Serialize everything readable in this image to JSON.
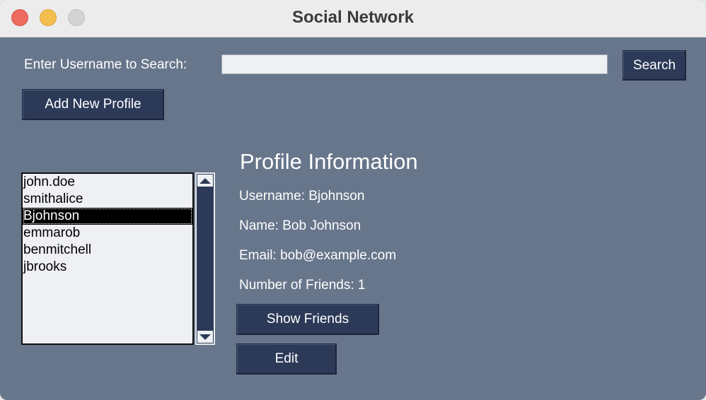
{
  "window": {
    "title": "Social Network"
  },
  "search": {
    "label": "Enter Username to Search:",
    "value": "",
    "placeholder": "",
    "button_label": "Search"
  },
  "actions": {
    "add_profile_label": "Add New Profile",
    "show_friends_label": "Show Friends",
    "edit_label": "Edit"
  },
  "profile_list": {
    "items": [
      "john.doe",
      "smithalice",
      "Bjohnson",
      "emmarob",
      "benmitchell",
      "jbrooks"
    ],
    "selected": "Bjohnson"
  },
  "profile": {
    "heading": "Profile Information",
    "username_line": "Username: Bjohnson",
    "name_line": "Name: Bob Johnson",
    "email_line": "Email: bob@example.com",
    "friends_line": "Number of Friends: 1"
  },
  "colors": {
    "background": "#67768b",
    "button": "#2c3a58",
    "text": "#ffffff",
    "list_background": "#eef0f3",
    "selection": "#000000"
  }
}
